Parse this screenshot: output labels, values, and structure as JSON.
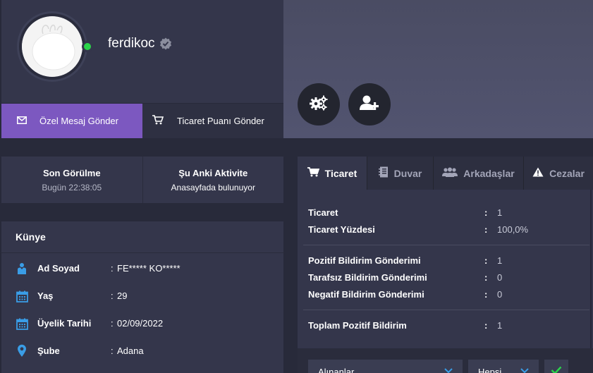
{
  "profile": {
    "username": "ferdikoc",
    "online": true,
    "colors": {
      "online": "#2bd54a",
      "accent": "#7c58c0"
    }
  },
  "actions": {
    "message_label": "Özel Mesaj Gönder",
    "trade_points_label": "Ticaret Puanı Gönder",
    "settings_icon": "gears-icon",
    "add_friend_icon": "user-plus-icon"
  },
  "activity": {
    "last_seen_title": "Son Görülme",
    "last_seen_value": "Bugün 22:38:05",
    "current_title": "Şu Anki Aktivite",
    "current_value": "Anasayfada bulunuyor"
  },
  "kunye": {
    "title": "Künye",
    "rows": [
      {
        "icon": "user-icon",
        "label": "Ad Soyad",
        "value": "FE***** KO*****"
      },
      {
        "icon": "calendar-icon",
        "label": "Yaş",
        "value": "29"
      },
      {
        "icon": "calendar-icon",
        "label": "Üyelik Tarihi",
        "value": "02/09/2022"
      },
      {
        "icon": "map-pin-icon",
        "label": "Şube",
        "value": "Adana"
      }
    ]
  },
  "tabs": [
    {
      "label": "Ticaret",
      "icon": "cart-icon",
      "active": true
    },
    {
      "label": "Duvar",
      "icon": "notebook-icon",
      "active": false
    },
    {
      "label": "Arkadaşlar",
      "icon": "users-icon",
      "active": false
    },
    {
      "label": "Cezalar",
      "icon": "warning-icon",
      "active": false
    }
  ],
  "stats": {
    "group1": [
      {
        "label": "Ticaret",
        "value": "1"
      },
      {
        "label": "Ticaret Yüzdesi",
        "value": "100,0%"
      }
    ],
    "group2": [
      {
        "label": "Pozitif Bildirim Gönderimi",
        "value": "1"
      },
      {
        "label": "Tarafsız Bildirim Gönderimi",
        "value": "0"
      },
      {
        "label": "Negatif Bildirim Gönderimi",
        "value": "0"
      }
    ],
    "group3": [
      {
        "label": "Toplam Pozitif Bildirim",
        "value": "1"
      }
    ]
  },
  "filters": {
    "type_selected": "Alınanlar",
    "scope_selected": "Hepsi"
  }
}
